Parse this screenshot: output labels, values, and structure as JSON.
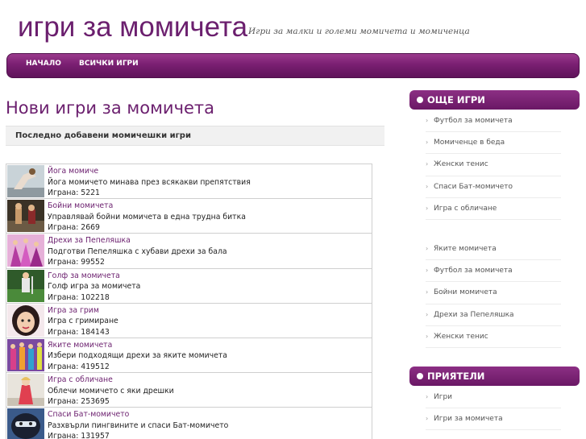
{
  "site": {
    "title": "игри за момичета",
    "tagline": "Игри за малки и големи момичета и момиченца"
  },
  "nav": {
    "home": "НАЧАЛО",
    "all_games": "ВСИЧКИ ИГРИ"
  },
  "main": {
    "heading": "Нови игри за момичета",
    "subheading": "Последно добавени момичешки игри",
    "games": [
      {
        "title": "Йога момиче",
        "desc": "Йога момичето минава през всякакви препятствия",
        "plays": "Играна: 5221"
      },
      {
        "title": "Бойни момичета",
        "desc": "Управлявай бойни момичета в една трудна битка",
        "plays": "Играна: 2669"
      },
      {
        "title": "Дрехи за Пепеляшка",
        "desc": "Подготви Пепеляшка с хубави дрехи за бала",
        "plays": "Играна: 99552"
      },
      {
        "title": "Голф за момичета",
        "desc": "Голф игра за момичета",
        "plays": "Играна: 102218"
      },
      {
        "title": "Игра за грим",
        "desc": "Игра с гримиране",
        "plays": "Играна: 184143"
      },
      {
        "title": "Яките момичета",
        "desc": "Избери подходящи дрехи за яките момичета",
        "plays": "Играна: 419512"
      },
      {
        "title": "Игра с обличане",
        "desc": "Облечи момичето с яки дрешки",
        "plays": "Играна: 253695"
      },
      {
        "title": "Спаси Бат-момичето",
        "desc": "Разхвърли пингвините и спаси Бат-момичето",
        "plays": "Играна: 131957"
      }
    ]
  },
  "sidebar": {
    "more_title": "ОЩЕ ИГРИ",
    "more_items": [
      "Футбол за момичета",
      "Момиченце в беда",
      "Женски тенис",
      "Спаси Бат-момичето",
      "Игра с обличане"
    ],
    "more_items_2": [
      "Яките момичета",
      "Футбол за момичета",
      "Бойни момичета",
      "Дрехи за Пепеляшка",
      "Женски тенис"
    ],
    "friends_title": "ПРИЯТЕЛИ",
    "friends_items": [
      "Игри",
      "Игри за момичета"
    ]
  },
  "colors": {
    "brand": "#6b1f6e",
    "nav_bg": "#7a1f72"
  }
}
